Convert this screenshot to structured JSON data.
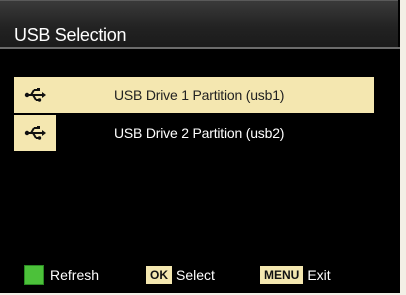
{
  "title": "USB Selection",
  "items": [
    {
      "label": "USB Drive 1 Partition (usb1)",
      "icon": "usb-icon",
      "selected": true
    },
    {
      "label": "USB Drive 2 Partition (usb2)",
      "icon": "usb-icon",
      "selected": false
    }
  ],
  "footer": {
    "refresh_label": "Refresh",
    "ok_key": "OK",
    "select_label": "Select",
    "menu_key": "MENU",
    "exit_label": "Exit"
  },
  "colors": {
    "selection": "#f4e7b0",
    "green_key": "#4cc13a"
  }
}
